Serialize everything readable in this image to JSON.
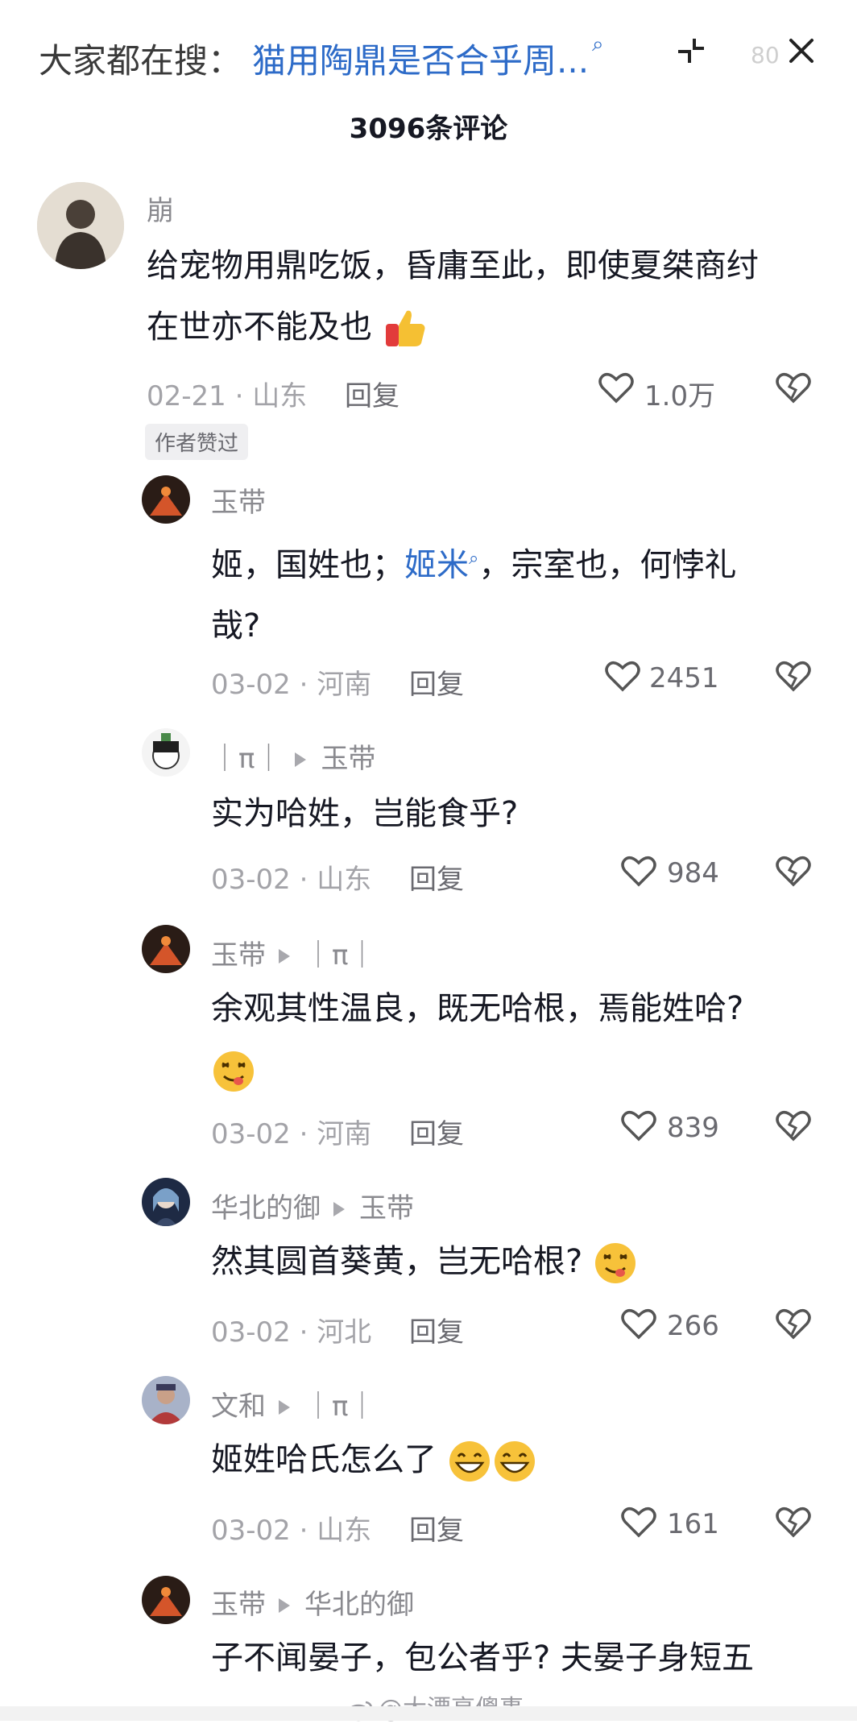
{
  "header": {
    "search_prefix": "大家都在搜：",
    "search_query": "猫用陶鼎是否合乎周...",
    "faint_count": "80",
    "title": "3096条评论"
  },
  "comments": [
    {
      "author": "崩",
      "text_a": "给宠物用鼎吃饭，昏庸至此，即使夏桀商纣",
      "text_b": "在世亦不能及也",
      "date_loc": "02-21 · 山东",
      "reply": "回复",
      "likes": "1.0万",
      "badge": "作者赞过"
    },
    {
      "author": "玉带",
      "text_a": "姬，国姓也；",
      "link": "姬米",
      "text_b": "，宗室也，何悖礼",
      "text_c": "哉?",
      "date_loc": "03-02 · 河南",
      "reply": "回复",
      "likes": "2451"
    },
    {
      "author": "｜π｜",
      "reply_to": "玉带",
      "text": "实为哈姓，岂能食乎?",
      "date_loc": "03-02 · 山东",
      "reply": "回复",
      "likes": "984"
    },
    {
      "author": "玉带",
      "reply_to": "｜π｜",
      "text": "余观其性温良，既无哈根，焉能姓哈?",
      "date_loc": "03-02 · 河南",
      "reply": "回复",
      "likes": "839"
    },
    {
      "author": "华北的御",
      "reply_to": "玉带",
      "text": "然其圆首葵黄，岂无哈根?",
      "date_loc": "03-02 · 河北",
      "reply": "回复",
      "likes": "266"
    },
    {
      "author": "文和",
      "reply_to": "｜π｜",
      "text": "姬姓哈氏怎么了",
      "date_loc": "03-02 · 山东",
      "reply": "回复",
      "likes": "161"
    },
    {
      "author": "玉带",
      "reply_to": "华北的御",
      "text": "子不闻晏子，包公者乎? 夫晏子身短五"
    }
  ],
  "watermark": "@大漂亮傻事",
  "colors": {
    "link": "#2d6bc8",
    "meta": "#a3a3a8",
    "text": "#161823"
  }
}
